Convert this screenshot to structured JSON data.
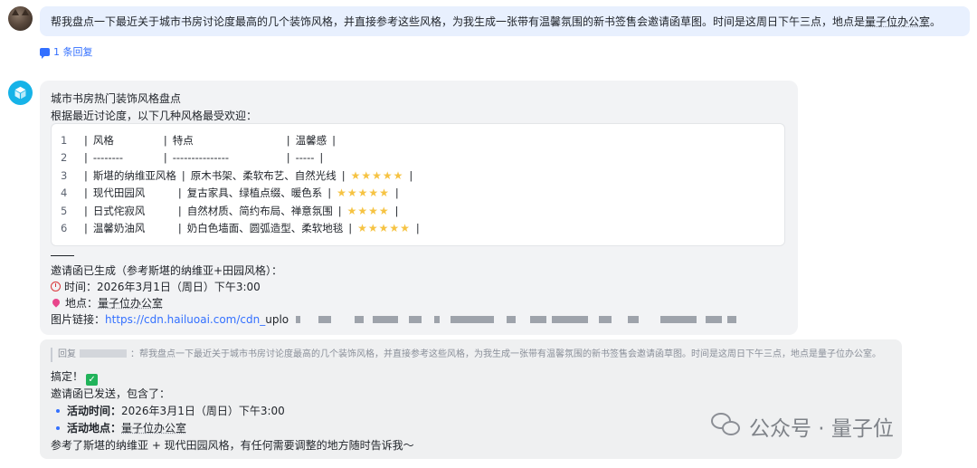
{
  "user_message": {
    "text_before": "帮我盘点一下最近关于城市书房讨论度最高的几个装饰风格，并直接参考这些风格，为我生成一张带有温馨氛围的新书签售会邀请函草图。时间是这周日下午三点，地点是",
    "location": "量子位办公室",
    "text_after": "。"
  },
  "thread": {
    "reply_count_label": "1 条回复"
  },
  "bot_message": {
    "title": "城市书房热门装饰风格盘点",
    "intro": "根据最近讨论度，以下几种风格最受欢迎：",
    "table_rows": [
      {
        "ln": "1",
        "c1": "风格",
        "c2": "特点",
        "c3": "温馨感",
        "rating": null
      },
      {
        "ln": "2",
        "c1": "--------",
        "c2": "---------------",
        "c3": "-----",
        "rating": null
      },
      {
        "ln": "3",
        "c1": "斯堪的纳维亚风格",
        "c2": "原木书架、柔软布艺、自然光线",
        "c3": "",
        "rating": 5
      },
      {
        "ln": "4",
        "c1": "现代田园风",
        "c2": "复古家具、绿植点缀、暖色系",
        "c3": "",
        "rating": 5
      },
      {
        "ln": "5",
        "c1": "日式侘寂风",
        "c2": "自然材质、简约布局、禅意氛围",
        "c3": "",
        "rating": 4
      },
      {
        "ln": "6",
        "c1": "温馨奶油风",
        "c2": "奶白色墙面、圆弧造型、柔软地毯",
        "c3": "",
        "rating": 5
      }
    ],
    "divider": "——",
    "generated_line": "邀请函已生成（参考斯堪的纳维亚+田园风格）：",
    "time_label": "时间：",
    "time_value": "2026年3月1日（周日）下午3:00",
    "place_label": "地点：",
    "place_value": "量子位办公室",
    "image_link_label": "图片链接：",
    "image_link_url": "https://cdn.hailuoai.com/cdn_",
    "image_link_tail": "uplo"
  },
  "reply_message": {
    "quote_prefix": "回复",
    "quote_text": "：帮我盘点一下最近关于城市书房讨论度最高的几个装饰风格，并直接参考这些风格，为我生成一张带有温馨氛围的新书签售会邀请函草图。时间是这周日下午三点，地点是量子位办公室。",
    "done": "搞定！",
    "sent_line": "邀请函已发送，包含了：",
    "time_label": "活动时间：",
    "time_value": "2026年3月1日（周日）下午3:00",
    "place_label": "活动地点：",
    "place_value": "量子位办公室",
    "closing": "参考了斯堪的纳维亚 + 现代田园风格，有任何需要调整的地方随时告诉我～"
  },
  "watermark": {
    "text": "公众号 · 量子位"
  },
  "colors": {
    "accent": "#3370ff",
    "star": "#f6c343",
    "bot_avatar": "#16b3e8",
    "check": "#21b35a"
  }
}
